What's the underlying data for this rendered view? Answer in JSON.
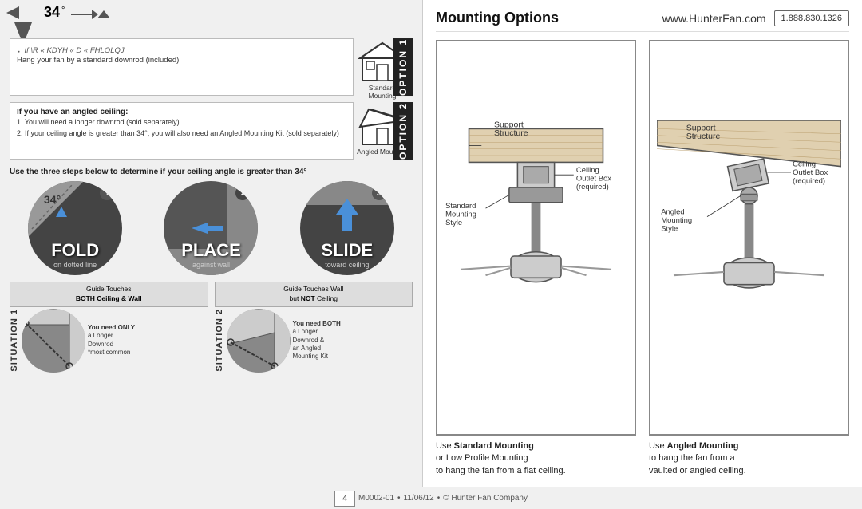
{
  "left": {
    "angle": "34°",
    "option1": {
      "label": "OPTION 1",
      "encoded_title": "If you have a flat ceiling",
      "description": "Hang your fan by a standard downrod (included)",
      "house_label": "Standard Mounting"
    },
    "option2": {
      "label": "OPTION 2",
      "title": "If you have an angled ceiling:",
      "point1": "1. You will need a longer downrod (sold separately)",
      "point2": "2. If your ceiling angle is greater than 34°, you will also need an Angled Mounting Kit (sold separately)",
      "house_label": "Angled Mounting"
    },
    "steps_instruction": "Use the three steps below to determine if your ceiling angle is greater than 34°",
    "step1": {
      "number": "1",
      "main": "FOLD",
      "sub": "on dotted line"
    },
    "step2": {
      "number": "2",
      "main": "PLACE",
      "sub": "against wall"
    },
    "step3": {
      "number": "3",
      "main": "SLIDE",
      "sub": "toward ceiling"
    },
    "sit1": {
      "label": "SITUATION 1",
      "info_title": "Guide Touches",
      "info_bold": "BOTH Ceiling & Wall",
      "desc_bold": "You need ONLY",
      "desc": "a Longer Downrod\n*most common"
    },
    "sit2": {
      "label": "SITUATION 2",
      "info_title": "Guide Touches Wall",
      "info_notbold": "but ",
      "info_bold": "NOT",
      "info_after": " Ceiling",
      "desc_bold": "You need BOTH",
      "desc": "a Longer Downrod &\nan Angled Mounting Kit"
    }
  },
  "right": {
    "title": "Mounting Options",
    "website": "www.HunterFan.com",
    "phone": "1.888.830.1326",
    "diagram1": {
      "caption_start": "Use ",
      "caption_bold": "Standard Mounting",
      "caption_end": "\nor Low Profile Mounting\nto hang the fan from a\nflat ceiling.",
      "labels": {
        "support": "Support Structure",
        "standard": "Standard Mounting Style",
        "outlet": "Ceiling Outlet Box (required)"
      }
    },
    "diagram2": {
      "caption_start": "Use ",
      "caption_bold": "Angled Mounting",
      "caption_end": "\nto hang the fan from a\nvaulted or angled ceiling.",
      "labels": {
        "support": "Support Structure",
        "outlet": "Ceiling Outlet Box (required)",
        "angled": "Angled Mounting Style"
      }
    }
  },
  "footer": {
    "doc_num": "M0002-01",
    "date": "11/06/12",
    "company": "© Hunter Fan Company",
    "page": "4"
  }
}
